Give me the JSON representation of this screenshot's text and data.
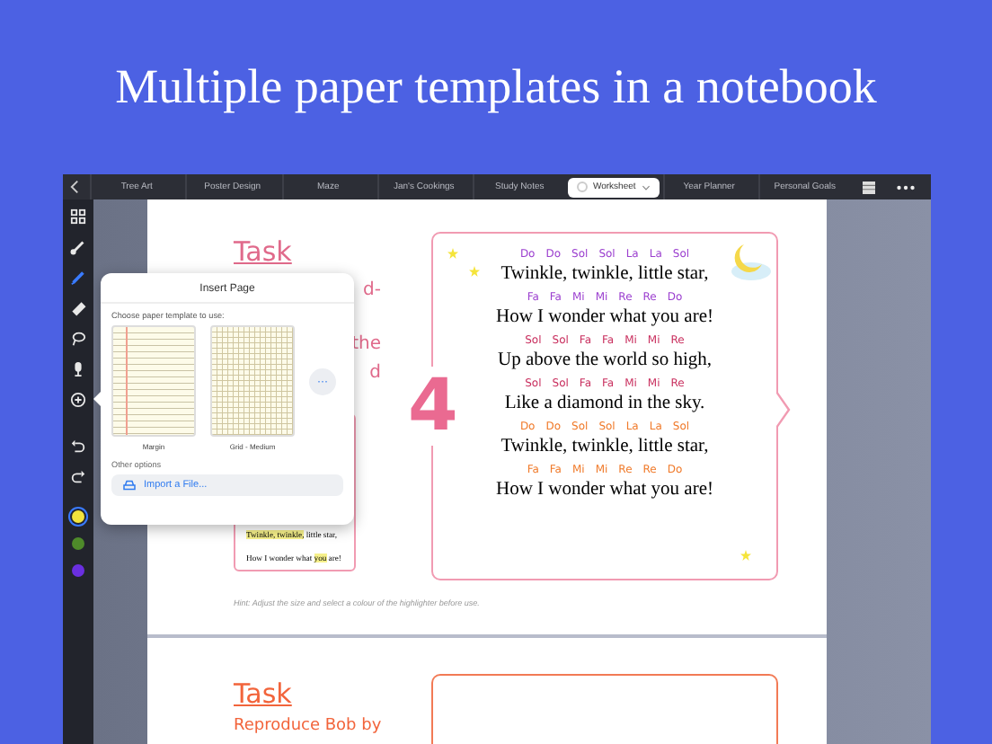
{
  "headline": "Multiple paper templates in a notebook",
  "tabs": [
    {
      "label": "Tree Art",
      "selected": false
    },
    {
      "label": "Poster Design",
      "selected": false
    },
    {
      "label": "Maze",
      "selected": false
    },
    {
      "label": "Jan's Cookings",
      "selected": false
    },
    {
      "label": "Study Notes",
      "selected": false
    },
    {
      "label": "Worksheet",
      "selected": true
    },
    {
      "label": "Year Planner",
      "selected": false
    },
    {
      "label": "Personal Goals",
      "selected": false
    }
  ],
  "toolbar": {
    "tools": [
      {
        "kind": "grid",
        "selected": false
      },
      {
        "kind": "brush",
        "selected": false
      },
      {
        "kind": "pen",
        "selected": true
      },
      {
        "kind": "eraser",
        "selected": false
      },
      {
        "kind": "lasso",
        "selected": false
      },
      {
        "kind": "mic",
        "selected": false
      },
      {
        "kind": "add",
        "selected": false
      },
      {
        "kind": "undo",
        "selected": false
      },
      {
        "kind": "redo",
        "selected": false
      }
    ],
    "colors": [
      {
        "color": "#f2e33c",
        "selected": true
      },
      {
        "color": "#4e8a2a",
        "selected": false
      },
      {
        "color": "#6a2fe0",
        "selected": false
      }
    ]
  },
  "page_1": {
    "task_title": "Task",
    "task_fragments": [
      "d-",
      "the",
      "d"
    ],
    "number": "4",
    "small_card": [
      [
        {
          "text": "Twinkle, twinkle,",
          "highlighted": true
        },
        {
          "text": " little star,",
          "highlighted": false
        }
      ],
      [
        {
          "text": "How I wonder what ",
          "highlighted": false
        },
        {
          "text": "you",
          "highlighted": true
        },
        {
          "text": " are!",
          "highlighted": false
        }
      ]
    ],
    "song": [
      {
        "color": "#9b3fcf",
        "notes": [
          "Do",
          "Do",
          "Sol",
          "Sol",
          "La",
          "La",
          "Sol"
        ],
        "lyric": "Twinkle, twinkle, little star,"
      },
      {
        "color": "#9b3fcf",
        "notes": [
          "Fa",
          "Fa",
          "Mi",
          "Mi",
          "Re",
          "Re",
          "Do"
        ],
        "lyric": "How I wonder what you are!"
      },
      {
        "color": "#c9305f",
        "notes": [
          "Sol",
          "Sol",
          "Fa",
          "Fa",
          "Mi",
          "Mi",
          "Re"
        ],
        "lyric": "Up above the world so high,"
      },
      {
        "color": "#c9305f",
        "notes": [
          "Sol",
          "Sol",
          "Fa",
          "Fa",
          "Mi",
          "Mi",
          "Re"
        ],
        "lyric": "Like a diamond in the sky."
      },
      {
        "color": "#f07a2a",
        "notes": [
          "Do",
          "Do",
          "Sol",
          "Sol",
          "La",
          "La",
          "Sol"
        ],
        "lyric": "Twinkle, twinkle, little star,"
      },
      {
        "color": "#f07a2a",
        "notes": [
          "Fa",
          "Fa",
          "Mi",
          "Mi",
          "Re",
          "Re",
          "Do"
        ],
        "lyric": "How I wonder what you are!"
      }
    ],
    "hint": "Hint:  Adjust the size and select a colour of the highlighter before use."
  },
  "page_2": {
    "task_title": "Task",
    "task_text": "Reproduce Bob by"
  },
  "insert_page": {
    "title": "Insert Page",
    "prompt": "Choose paper template to use:",
    "templates": [
      {
        "kind": "margin",
        "label": "Margin"
      },
      {
        "kind": "grid",
        "label": "Grid - Medium"
      }
    ],
    "more": "···",
    "other_options": "Other options",
    "import_button": "Import a File..."
  }
}
